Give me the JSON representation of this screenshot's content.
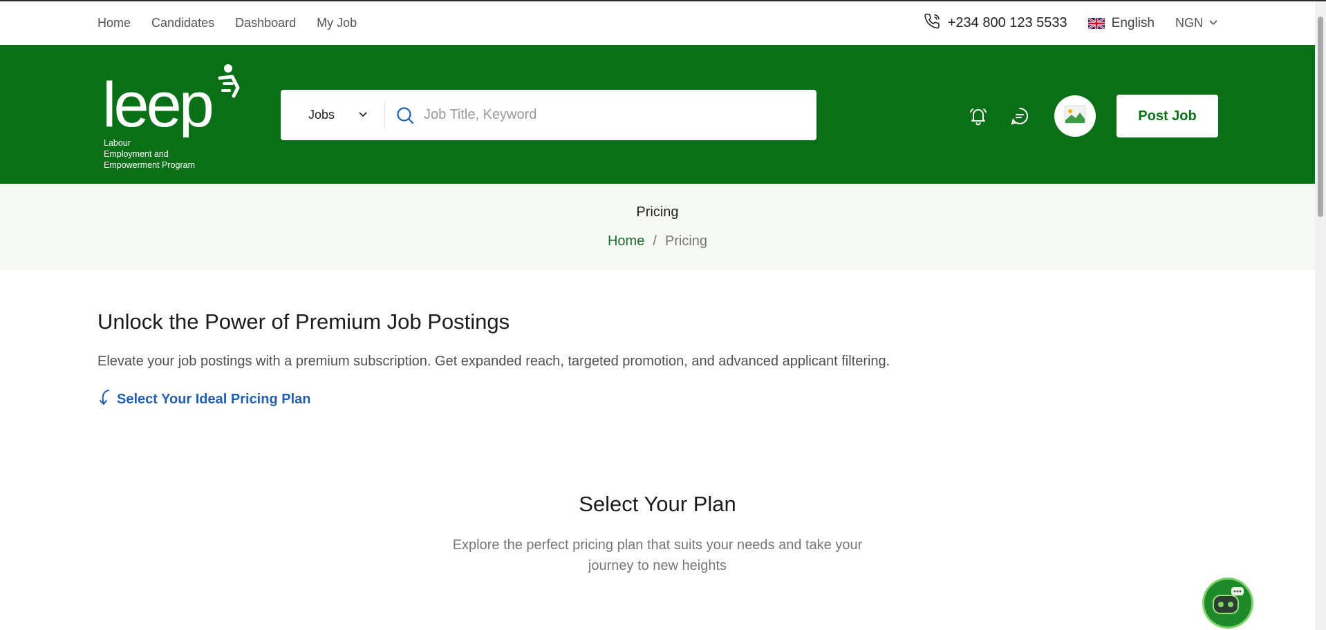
{
  "topnav": {
    "links": [
      "Home",
      "Candidates",
      "Dashboard",
      "My Job"
    ],
    "phone": "+234 800 123 5533",
    "language": "English",
    "currency": "NGN"
  },
  "header": {
    "logo_text": "leep",
    "logo_subtitle": [
      "Labour",
      "Employment and",
      "Empowerment Program"
    ],
    "search": {
      "category": "Jobs",
      "placeholder": "Job Title, Keyword"
    },
    "post_job_label": "Post Job"
  },
  "breadcrumb": {
    "title": "Pricing",
    "home": "Home",
    "separator": "/",
    "current": "Pricing"
  },
  "hero": {
    "title": "Unlock the Power of Premium Job Postings",
    "description": "Elevate your job postings with a premium subscription. Get expanded reach, targeted promotion, and advanced applicant filtering.",
    "link": "Select Your Ideal Pricing Plan"
  },
  "plans": {
    "title": "Select Your Plan",
    "subtitle": "Explore the perfect pricing plan that suits your needs and take your journey to new heights"
  },
  "colors": {
    "brand_green": "#0a7018",
    "link_blue": "#1f5fb5",
    "band_bg": "#f6f9f4"
  },
  "icons": [
    "phone-icon",
    "uk-flag-icon",
    "chevron-down-icon",
    "search-icon",
    "bell-icon",
    "chat-icon",
    "image-avatar-icon",
    "curved-arrow-icon",
    "chatbot-icon"
  ]
}
